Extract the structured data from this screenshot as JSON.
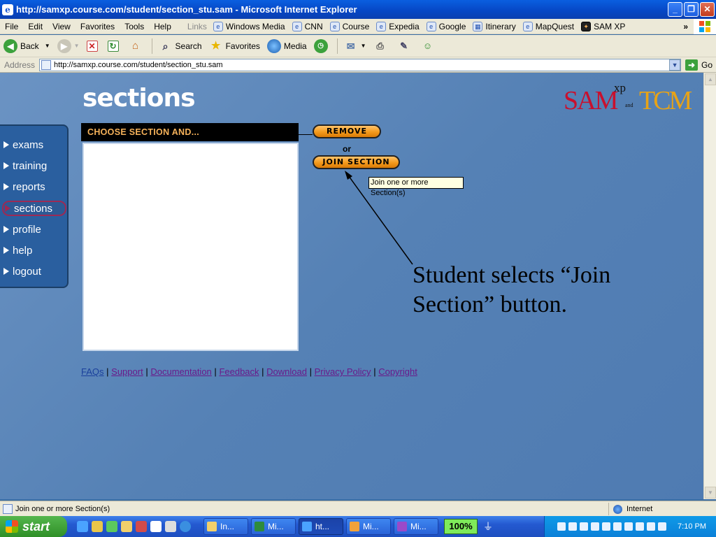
{
  "window": {
    "title": "http://samxp.course.com/student/section_stu.sam - Microsoft Internet Explorer"
  },
  "menubar": {
    "items": [
      "File",
      "Edit",
      "View",
      "Favorites",
      "Tools",
      "Help"
    ],
    "links_label": "Links",
    "links": [
      "Windows Media",
      "CNN",
      "Course",
      "Expedia",
      "Google",
      "Itinerary",
      "MapQuest",
      "SAM XP"
    ]
  },
  "toolbar": {
    "back": "Back",
    "search": "Search",
    "favorites": "Favorites",
    "media": "Media"
  },
  "address": {
    "label": "Address",
    "url": "http://samxp.course.com/student/section_stu.sam",
    "go": "Go"
  },
  "page": {
    "title": "sections",
    "logo": {
      "sam": "SAM",
      "xp": "xp",
      "and": "and",
      "tcm": "TCM"
    },
    "nav": [
      {
        "label": "exams",
        "active": false
      },
      {
        "label": "training",
        "active": false
      },
      {
        "label": "reports",
        "active": false
      },
      {
        "label": "sections",
        "active": true
      },
      {
        "label": "profile",
        "active": false
      },
      {
        "label": "help",
        "active": false
      },
      {
        "label": "logout",
        "active": false
      }
    ],
    "panel_header": "CHOOSE SECTION AND...",
    "remove_button": "REMOVE",
    "or_label": "or",
    "join_button": "JOIN SECTION",
    "tooltip": "Join one or more Section(s)",
    "annotation_line1": "Student selects “Join",
    "annotation_line2": "Section” button.",
    "footer_links": [
      "FAQs",
      "Support",
      "Documentation",
      "Feedback",
      "Download",
      "Privacy Policy",
      "Copyright"
    ],
    "footer_separator": "|"
  },
  "statusbar": {
    "text": "Join one or more Section(s)",
    "zone": "Internet"
  },
  "taskbar": {
    "start": "start",
    "tasks": [
      {
        "label": "In...",
        "active": false
      },
      {
        "label": "Mi...",
        "active": false
      },
      {
        "label": "ht...",
        "active": true
      },
      {
        "label": "Mi...",
        "active": false
      },
      {
        "label": "Mi...",
        "active": false
      }
    ],
    "zoom": "100%",
    "clock": "7:10 PM"
  },
  "colors": {
    "accent_orange": "#f39a1c",
    "header_text": "#f6b25a",
    "nav_bg": "#2a5f9f",
    "active_outline": "#9c2a55"
  }
}
